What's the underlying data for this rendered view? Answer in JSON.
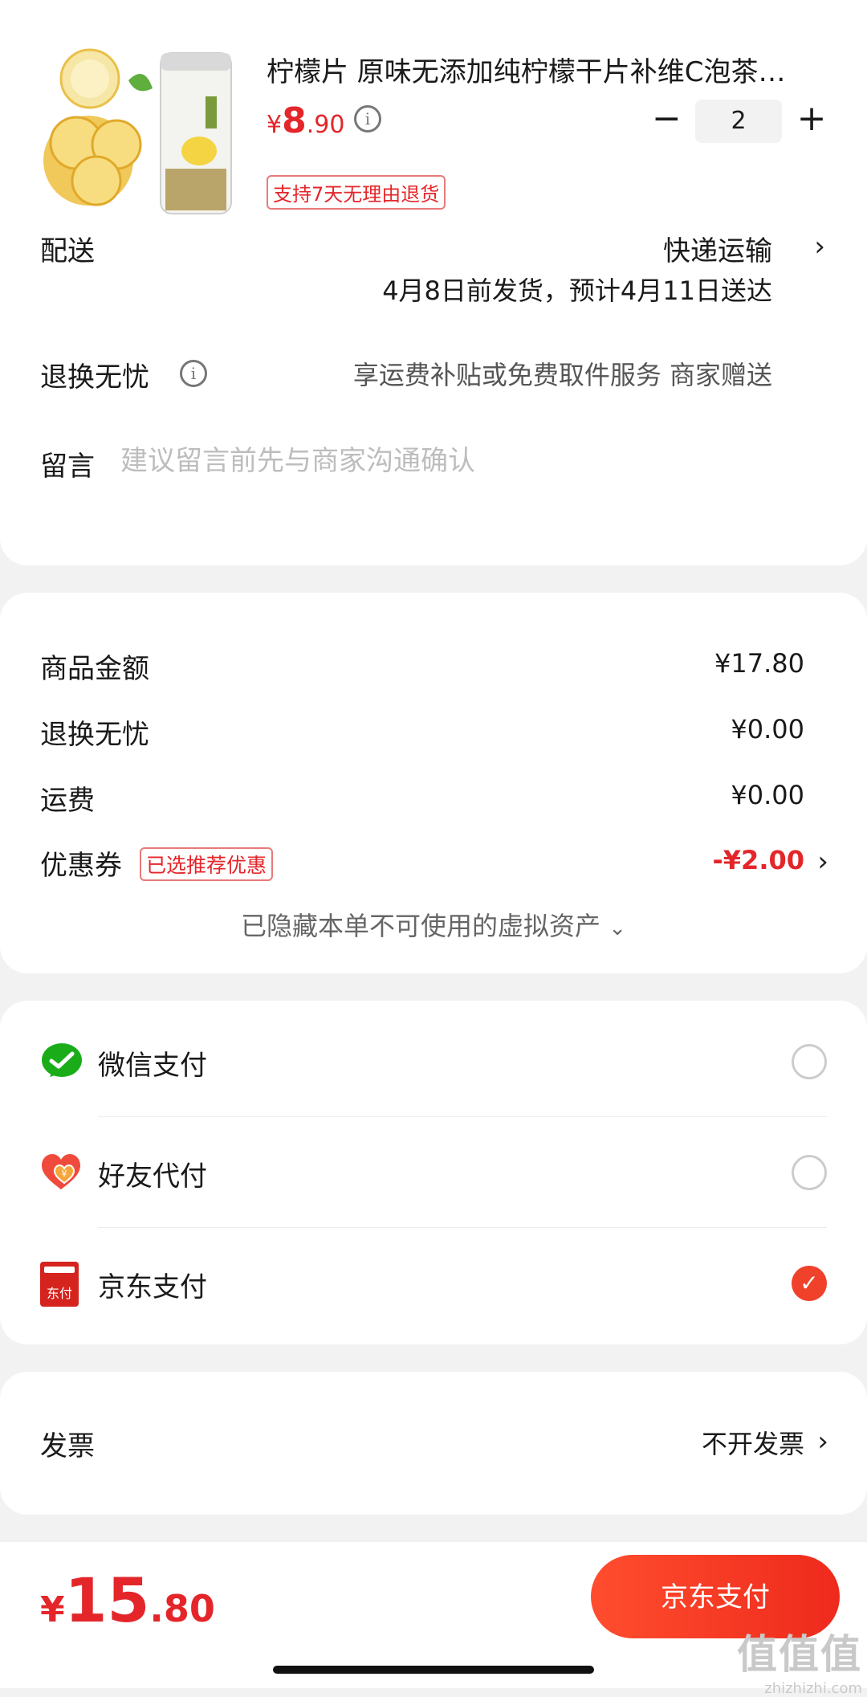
{
  "product": {
    "title": "柠檬片 原味无添加纯柠檬干片补维C泡茶…",
    "price_yen": "¥",
    "price_int": "8",
    "price_dec": ".90",
    "return_tag": "支持7天无理由退货",
    "quantity": "2",
    "image_label": "柠檬片"
  },
  "delivery": {
    "label": "配送",
    "method": "快递运输",
    "date": "4月8日前发货，预计4月11日送达"
  },
  "return_service": {
    "label": "退换无忧",
    "desc": "享运费补贴或免费取件服务  商家赠送"
  },
  "note": {
    "label": "留言",
    "placeholder": "建议留言前先与商家沟通确认"
  },
  "amounts": {
    "goods_label": "商品金额",
    "goods_value": "¥17.80",
    "return_label": "退换无忧",
    "return_value": "¥0.00",
    "shipping_label": "运费",
    "shipping_value": "¥0.00",
    "coupon_label": "优惠券",
    "coupon_tag": "已选推荐优惠",
    "coupon_value": "-¥2.00",
    "hidden_assets": "已隐藏本单不可使用的虚拟资产"
  },
  "payment": {
    "methods": [
      {
        "label": "微信支付",
        "icon": "wechat-pay-icon",
        "selected": false
      },
      {
        "label": "好友代付",
        "icon": "friend-pay-icon",
        "selected": false
      },
      {
        "label": "京东支付",
        "icon": "jd-pay-icon",
        "selected": true
      }
    ],
    "jd_icon_text": "东付"
  },
  "invoice": {
    "label": "发票",
    "value": "不开发票"
  },
  "footer": {
    "total_yen": "¥",
    "total_int": "15",
    "total_dec": ".80",
    "pay_button": "京东支付"
  },
  "watermark": {
    "line1": "值值值",
    "line2": "zhizhizhi.com"
  },
  "colors": {
    "accent": "#e4262a",
    "button": "#f0412b",
    "wechat": "#1aad19"
  }
}
